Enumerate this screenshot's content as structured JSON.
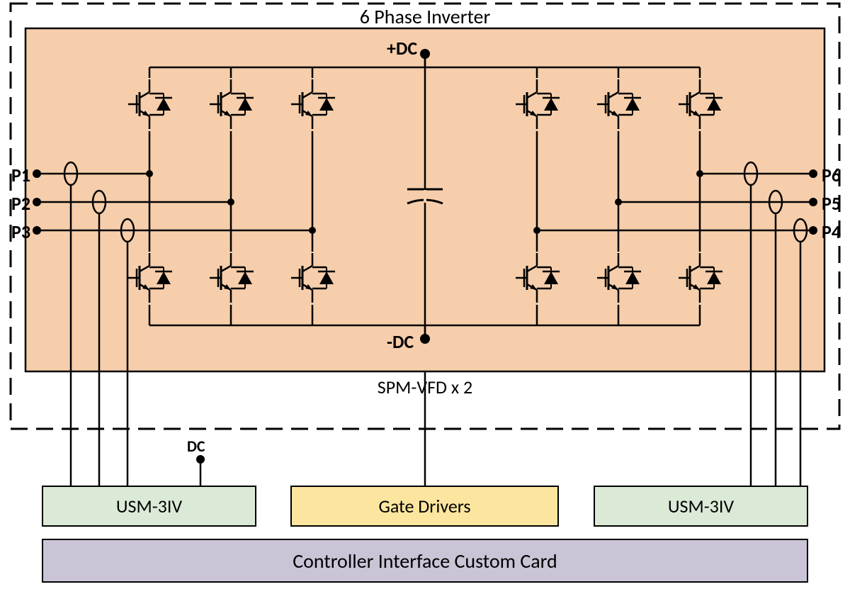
{
  "title": "6 Phase Inverter",
  "spm_label": "SPM-VFD x 2",
  "dc_plus": "+DC",
  "dc_minus": "-DC",
  "dc_label": "DC",
  "phases": {
    "left": [
      "P1",
      "P2",
      "P3"
    ],
    "right": [
      "P6",
      "P5",
      "P4"
    ]
  },
  "blocks": {
    "usm_left": "USM-3IV",
    "gate_drivers": "Gate Drivers",
    "usm_right": "USM-3IV",
    "controller": "Controller Interface Custom Card"
  }
}
